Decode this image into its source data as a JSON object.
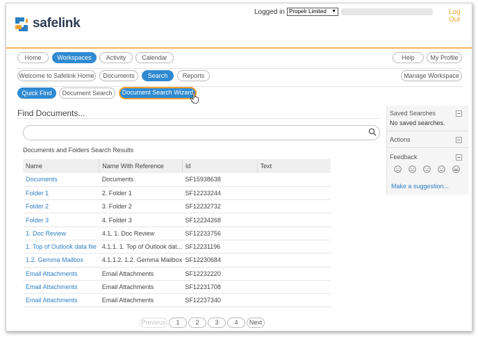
{
  "brand": {
    "name": "safelink",
    "mark_colors": [
      "#2b7fc3",
      "#f1a432"
    ]
  },
  "header": {
    "logged_in_label": "Logged in to",
    "org_select_value": "Propelr Limited",
    "logout_label": "Log Out"
  },
  "main_nav": {
    "left": [
      "Home",
      "Workspaces",
      "Activity",
      "Calendar"
    ],
    "active": "Workspaces",
    "right": [
      "Help",
      "My Profile"
    ]
  },
  "sub_nav": {
    "left": [
      "Welcome to Safelink Home",
      "Documents",
      "Search",
      "Reports"
    ],
    "active": "Search",
    "right": "Manage Workspace"
  },
  "search_tabs": {
    "items": [
      "Quick Find",
      "Document Search",
      "Document Search Wizard"
    ],
    "active": [
      "Quick Find",
      "Document Search Wizard"
    ]
  },
  "find": {
    "title": "Find Documents...",
    "search_value": "",
    "results_label": "Documents and Folders Search Results"
  },
  "results": {
    "columns": [
      "Name",
      "Name With Reference",
      "Id",
      "Text"
    ],
    "rows": [
      {
        "name": "Documents",
        "ref": "Documents",
        "id": "SF15938638",
        "text": ""
      },
      {
        "name": "Folder 1",
        "ref": "2. Folder 1",
        "id": "SF12233244",
        "text": ""
      },
      {
        "name": "Folder 2",
        "ref": "3. Folder 2",
        "id": "SF12232732",
        "text": ""
      },
      {
        "name": "Folder 3",
        "ref": "4. Folder 3",
        "id": "SF12234268",
        "text": ""
      },
      {
        "name": "1. Doc Review",
        "ref": "4.1. 1. Doc Review",
        "id": "SF12233756",
        "text": ""
      },
      {
        "name": "1. Top of Outlook data file",
        "ref": "4.1.1. 1. Top of Outlook dat...",
        "id": "SF12231196",
        "text": ""
      },
      {
        "name": "1.2. Gemma Mailbox",
        "ref": "4.1.1.2. 1.2. Gemma Mailbox",
        "id": "SF12230684",
        "text": ""
      },
      {
        "name": "Email Attachments",
        "ref": "Email Attachments",
        "id": "SF12232220",
        "text": ""
      },
      {
        "name": "Email Attachments",
        "ref": "Email Attachments",
        "id": "SF12231708",
        "text": ""
      },
      {
        "name": "Email Attachments",
        "ref": "Email Attachments",
        "id": "SF12237340",
        "text": ""
      }
    ]
  },
  "pager": {
    "previous": "Previous",
    "pages": [
      "1",
      "2",
      "3",
      "4"
    ],
    "next": "Next"
  },
  "sidebar": {
    "saved_searches": {
      "title": "Saved Searches",
      "empty_text": "No saved searches."
    },
    "actions": {
      "title": "Actions"
    },
    "feedback": {
      "title": "Feedback",
      "faces": [
        "very-sad-face-icon",
        "sad-face-icon",
        "neutral-face-icon",
        "happy-face-icon",
        "very-happy-face-icon"
      ],
      "suggest_label": "Make a suggestion..."
    }
  },
  "colors": {
    "accent": "#2f8ad2",
    "highlight": "#f1a432",
    "link": "#2f7ec4",
    "brand_text": "#2c3d52"
  }
}
